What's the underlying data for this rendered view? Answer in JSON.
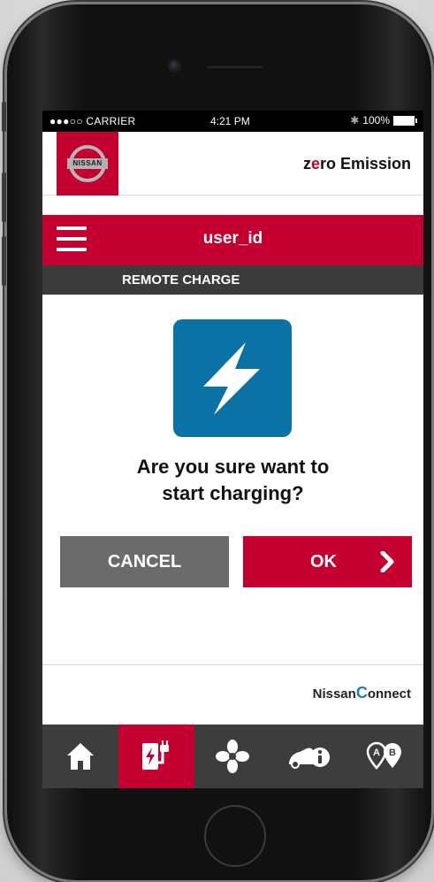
{
  "status_bar": {
    "carrier": "●●●○○ CARRIER",
    "time": "4:21 PM",
    "bluetooth": "✱",
    "battery": "100%"
  },
  "header": {
    "brand_logo": "NISSAN",
    "zero_prefix": "z",
    "zero_o": "e",
    "zero_suffix": "ro Emission"
  },
  "titlebar": {
    "username": "user_id"
  },
  "subbar": {
    "title": "REMOTE CHARGE"
  },
  "dialog": {
    "question_line1": "Are you sure want to",
    "question_line2": "start charging?",
    "cancel_label": "CANCEL",
    "ok_label": "OK"
  },
  "footer": {
    "brand_prefix": "Nissan",
    "brand_c": "C",
    "brand_suffix": "onnect"
  },
  "tabbar": {
    "tabs": [
      {
        "name": "home-icon",
        "active": false
      },
      {
        "name": "charge-icon",
        "active": true
      },
      {
        "name": "fan-icon",
        "active": false
      },
      {
        "name": "car-info-icon",
        "active": false
      },
      {
        "name": "map-route-icon",
        "active": false
      }
    ]
  },
  "colors": {
    "brand_red": "#c3002f",
    "bolt_blue": "#0b72a6",
    "dark_gray": "#3d3d3d",
    "cancel_gray": "#6b6b6b"
  }
}
